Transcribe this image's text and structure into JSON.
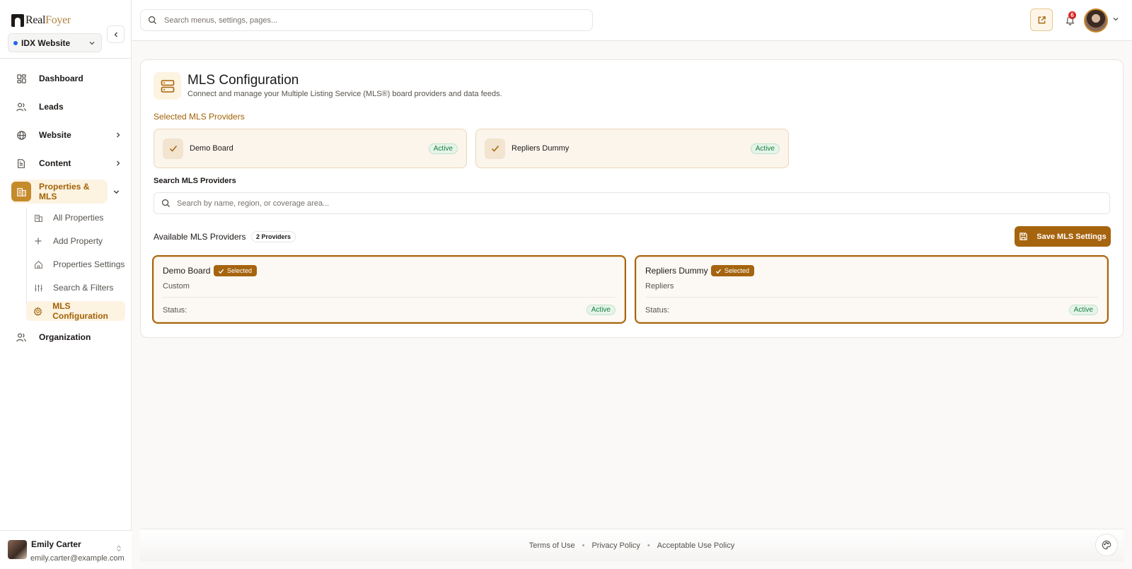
{
  "brand": {
    "name_part1": "Real",
    "name_part2": "Foyer"
  },
  "site_selector": {
    "value": "IDX Website"
  },
  "sidebar": {
    "items": [
      {
        "label": "Dashboard"
      },
      {
        "label": "Leads"
      },
      {
        "label": "Website"
      },
      {
        "label": "Content"
      },
      {
        "label": "Properties & MLS"
      },
      {
        "label": "Organization"
      }
    ],
    "sub_items": [
      {
        "label": "All Properties"
      },
      {
        "label": "Add Property"
      },
      {
        "label": "Properties Settings"
      },
      {
        "label": "Search & Filters"
      },
      {
        "label": "MLS Configuration"
      }
    ]
  },
  "user": {
    "name": "Emily Carter",
    "email": "emily.carter@example.com"
  },
  "topbar": {
    "search_placeholder": "Search menus, settings, pages...",
    "notification_count": "6"
  },
  "page": {
    "title": "MLS Configuration",
    "subtitle": "Connect and manage your Multiple Listing Service (MLS®) board providers and data feeds.",
    "selected_heading": "Selected MLS Providers",
    "selected_providers": [
      {
        "name": "Demo Board",
        "status": "Active"
      },
      {
        "name": "Repliers Dummy",
        "status": "Active"
      }
    ],
    "search_label": "Search MLS Providers",
    "search_placeholder": "Search by name, region, or coverage area...",
    "available_heading": "Available MLS Providers",
    "provider_count": "2 Providers",
    "save_label": "Save MLS Settings",
    "available_providers": [
      {
        "name": "Demo Board",
        "badge": "Selected",
        "type": "Custom",
        "status_label": "Status:",
        "status": "Active"
      },
      {
        "name": "Repliers Dummy",
        "badge": "Selected",
        "type": "Repliers",
        "status_label": "Status:",
        "status": "Active"
      }
    ]
  },
  "footer": {
    "links": [
      "Terms of Use",
      "Privacy Policy",
      "Acceptable Use Policy"
    ],
    "separator": "•"
  },
  "colors": {
    "accent": "#a6640f",
    "accent_light": "#fdf3e1",
    "active_green": "#15803d"
  }
}
